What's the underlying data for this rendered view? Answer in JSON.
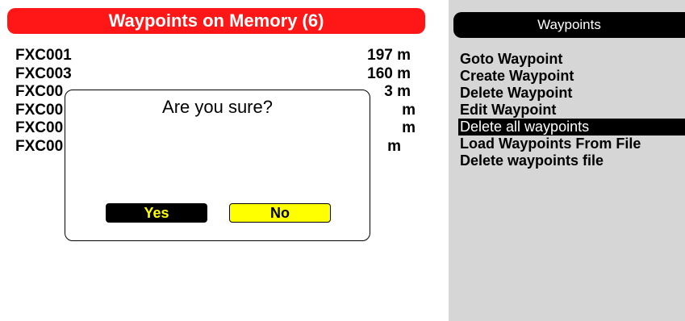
{
  "left_panel": {
    "title": "Waypoints on Memory (6)",
    "waypoints": [
      {
        "name": "FXC001",
        "distance": "197  m"
      },
      {
        "name": "FXC003",
        "distance": "160  m"
      },
      {
        "name": "FXC00",
        "distance": "3  m"
      },
      {
        "name": "FXC00",
        "distance": "m"
      },
      {
        "name": "FXC00",
        "distance": "m"
      },
      {
        "name": "FXC00",
        "distance": "m"
      }
    ],
    "dialog": {
      "message": "Are you sure?",
      "yes_label": "Yes",
      "no_label": "No"
    }
  },
  "right_panel": {
    "title": "Waypoints",
    "menu_items": [
      {
        "label": "Goto Waypoint"
      },
      {
        "label": "Create Waypoint"
      },
      {
        "label": "Delete Waypoint"
      },
      {
        "label": "Edit Waypoint"
      },
      {
        "label": "Delete all waypoints",
        "selected": true
      },
      {
        "label": "Load Waypoints From File"
      },
      {
        "label": "Delete waypoints file"
      }
    ]
  },
  "colors": {
    "title_bar": "#ff1616",
    "yes_button_bg": "#000000",
    "yes_button_text": "#ffff00",
    "no_button_bg": "#ffff00",
    "menu_bg": "#d6d6d6",
    "selected_item_bg": "#000000"
  }
}
